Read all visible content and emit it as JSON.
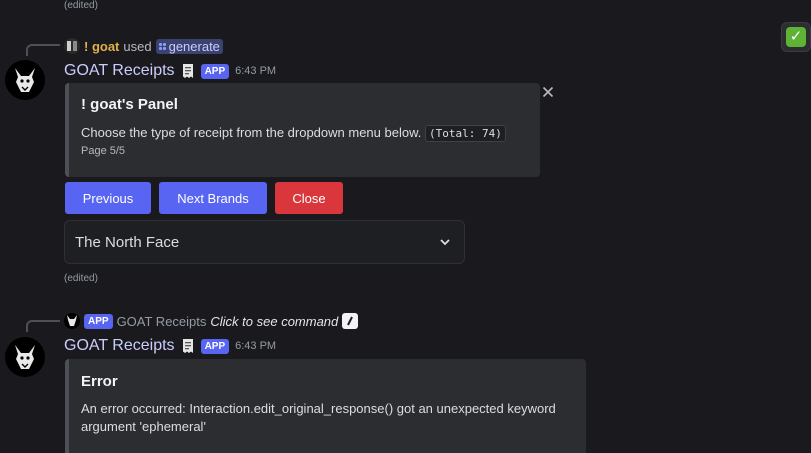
{
  "top_edited": "(edited)",
  "reaction": {
    "emoji": "✅"
  },
  "message1": {
    "reply": {
      "user": "! goat",
      "used_text": "used",
      "command": "generate"
    },
    "bot_name": "GOAT Receipts",
    "app_badge": "APP",
    "timestamp": "6:43 PM",
    "embed": {
      "title": "! goat's Panel",
      "description": "Choose the type of receipt from the dropdown menu below.",
      "code": "(Total: 74)",
      "footer": "Page 5/5"
    },
    "buttons": [
      {
        "label": "Previous",
        "style": "primary"
      },
      {
        "label": "Next Brands",
        "style": "primary"
      },
      {
        "label": "Close",
        "style": "danger"
      }
    ],
    "select": {
      "value": "The North Face"
    },
    "edited": "(edited)"
  },
  "message2": {
    "reply": {
      "app_badge": "APP",
      "bot": "GOAT Receipts",
      "command_text": "Click to see command"
    },
    "bot_name": "GOAT Receipts",
    "app_badge": "APP",
    "timestamp": "6:43 PM",
    "embed": {
      "title": "Error",
      "description": "An error occurred: Interaction.edit_original_response() got an unexpected keyword argument 'ephemeral'"
    }
  },
  "colors": {
    "background": "#1a1a1e",
    "blurple": "#5865f2",
    "danger": "#da373c",
    "embed_bg": "#2b2d31",
    "username": "#c9cdfb",
    "reply_user": "#e0b04a"
  }
}
